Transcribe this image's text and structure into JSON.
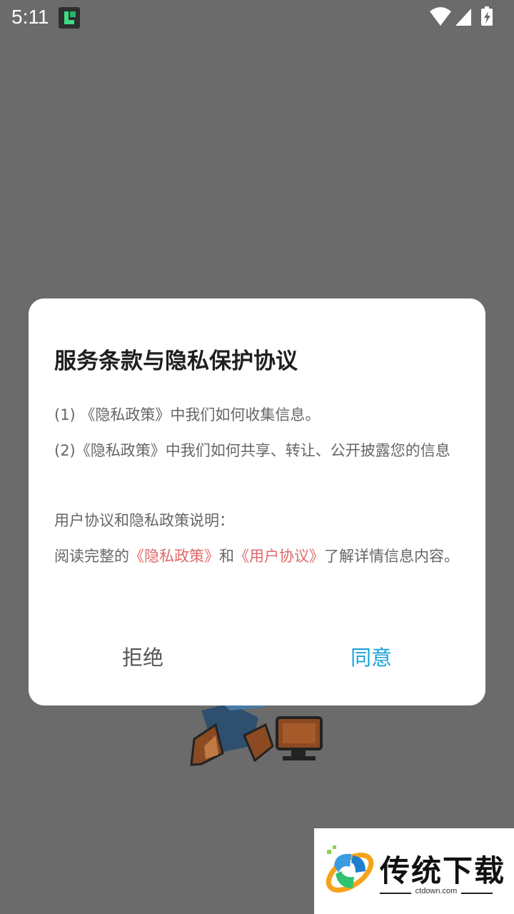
{
  "status_bar": {
    "time": "5:11"
  },
  "dialog": {
    "title": "服务条款与隐私保护协议",
    "item1": "(1) 《隐私政策》中我们如何收集信息。",
    "item2": "(2)《隐私政策》中我们如何共享、转让、公开披露您的信息",
    "section_heading": "用户协议和隐私政策说明：",
    "read_prefix": "阅读完整的",
    "privacy_link": "《隐私政策》",
    "read_and": "和",
    "user_agreement_link": "《用户协议》",
    "read_suffix": "了解详情信息内容。",
    "refuse_label": "拒绝",
    "agree_label": "同意",
    "link_color": "#e06767",
    "agree_color": "#1aa3dc"
  },
  "watermark": {
    "name": "传统下载",
    "url": "ctdown.com"
  }
}
